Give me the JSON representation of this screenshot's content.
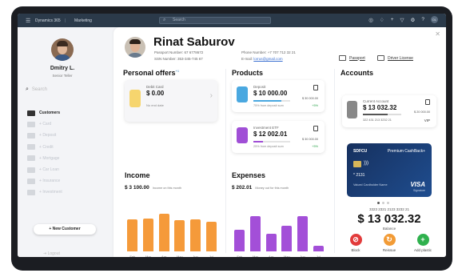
{
  "topbar": {
    "app": "Dynamics 365",
    "area": "Marketing",
    "search_placeholder": "Search"
  },
  "sidebar": {
    "user_name": "Dmitry L.",
    "user_role": "Senior Teller",
    "search_placeholder": "Search",
    "items": [
      {
        "label": "Customers",
        "active": true,
        "icon": "people-icon"
      },
      {
        "label": "Card",
        "active": false,
        "icon": "card-icon"
      },
      {
        "label": "Deposit",
        "active": false,
        "icon": "deposit-icon"
      },
      {
        "label": "Credit",
        "active": false,
        "icon": "credit-icon"
      },
      {
        "label": "Mortgage",
        "active": false,
        "icon": "mortgage-icon"
      },
      {
        "label": "Car Loan",
        "active": false,
        "icon": "car-icon"
      },
      {
        "label": "Insurance",
        "active": false,
        "icon": "insurance-icon"
      },
      {
        "label": "Investment",
        "active": false,
        "icon": "investment-icon"
      }
    ],
    "new_customer": "+ New Customer",
    "logout": "Logout"
  },
  "profile": {
    "name": "Rinat Saburov",
    "passport_line": "Passport Number: 67 6778672",
    "ssn_line": "SSN Number: 353-345-745 67",
    "phone_line": "Phone Number: +7 707 712 32 21",
    "email_label": "E-mail:",
    "email": "lorrus@gmail.com",
    "doc_passport": "Passport",
    "doc_license": "Driver License"
  },
  "offers": {
    "title": "Personal offers",
    "badge": "+1",
    "card_title": "Debit Card",
    "card_amount": "$ 0.00",
    "card_sub": "No end date"
  },
  "products": {
    "title": "Products",
    "items": [
      {
        "title": "Deposit",
        "amount": "$ 10 000.00",
        "right": "$ 30 000.00",
        "note": "75% from deposit sum",
        "pct": "+5%",
        "progress": 0.75,
        "color": "#4aa8e0"
      },
      {
        "title": "Investment ETF",
        "amount": "$ 12 002.01",
        "right": "$ 30 000.00",
        "note": "25% from deposit sum",
        "pct": "+5%",
        "progress": 0.25,
        "color": "#a04fd6"
      }
    ]
  },
  "accounts": {
    "title": "Accounts",
    "current_title": "Current Account",
    "current_amount": "$ 13 032.32",
    "current_right": "$ 20 000.00",
    "current_number": "322 431 213 3232 21",
    "current_tier": "VIP",
    "bank_name": "SDFCU",
    "bank_card_type": "Premium CashBack+",
    "bank_card_digits": "* 2131",
    "bank_card_holder": "Valued Cardholder Name",
    "bank_brand": "VISA",
    "bank_sub": "Signature",
    "acct_number": "3323 2321 2123 3232 21",
    "balance": "$ 13 032.32",
    "balance_label": "Balance",
    "actions": [
      {
        "label": "Block",
        "color": "#e23b3b",
        "icon": "block-icon"
      },
      {
        "label": "Reissue",
        "color": "#f29b36",
        "icon": "reissue-icon"
      },
      {
        "label": "Add plastic",
        "color": "#2fb14d",
        "icon": "plus-icon"
      }
    ]
  },
  "chart_data": [
    {
      "type": "bar",
      "title": "Income",
      "subtitle": "$ 3 100.00",
      "subtitle_note": "Income on this month",
      "categories": [
        "Feb",
        "Mar",
        "Apr",
        "May",
        "Jun",
        "Jul"
      ],
      "values": [
        32,
        33,
        38,
        31,
        32,
        30
      ],
      "color": "#f59a3a"
    },
    {
      "type": "bar",
      "title": "Expenses",
      "subtitle": "$ 202.01",
      "subtitle_note": "Money out for this month",
      "categories": [
        "Feb",
        "Mar",
        "Apr",
        "May",
        "Jun",
        "Jul"
      ],
      "values": [
        22,
        35,
        18,
        26,
        35,
        6
      ],
      "color": "#a34fd8"
    }
  ]
}
